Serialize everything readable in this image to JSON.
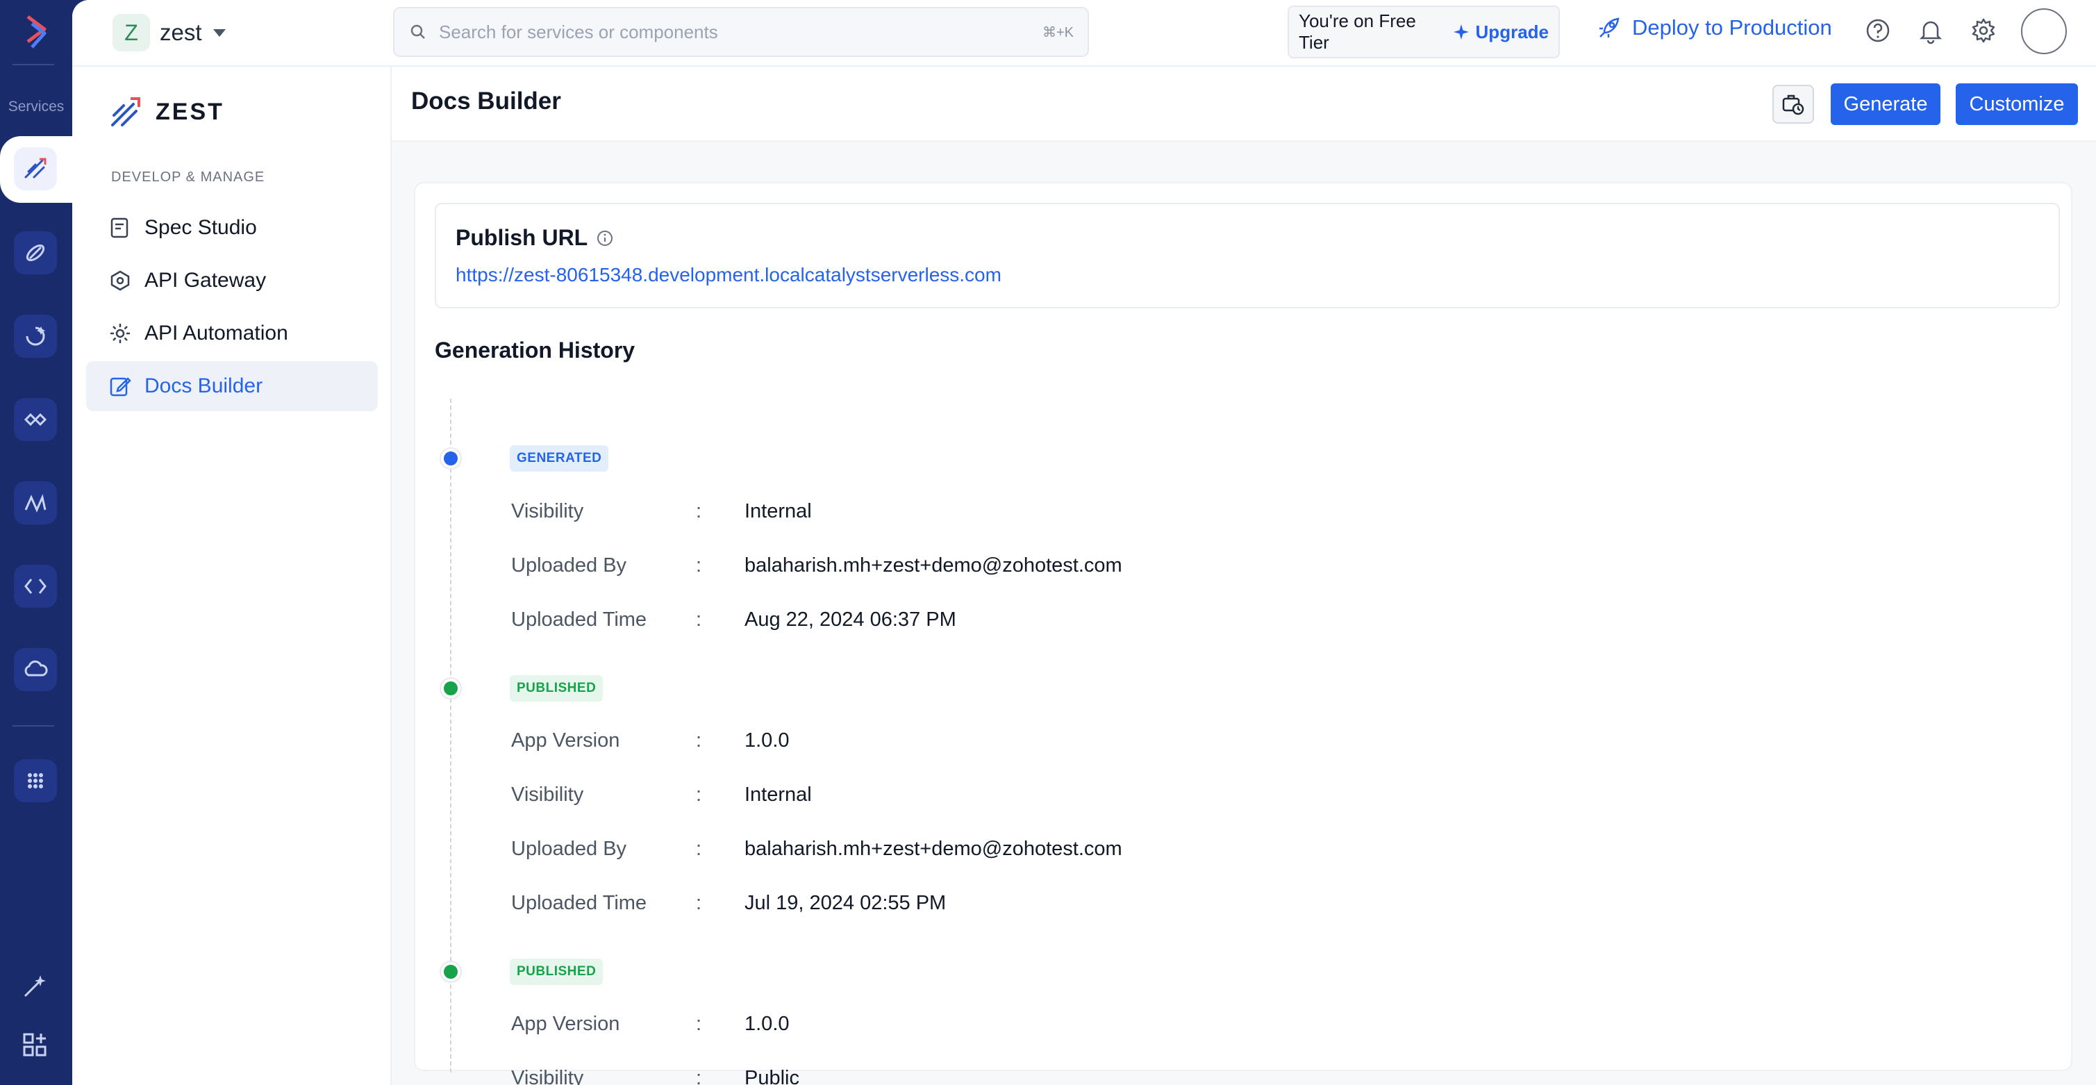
{
  "rail": {
    "services_label": "Services"
  },
  "project": {
    "initial": "Z",
    "name": "zest"
  },
  "search": {
    "placeholder": "Search for services or components",
    "shortcut": "⌘+K"
  },
  "tier": {
    "text": "You're on Free Tier",
    "upgrade_label": "Upgrade"
  },
  "deploy_label": "Deploy to Production",
  "brand": {
    "name": "ZEST"
  },
  "sidenav": {
    "section": "DEVELOP & MANAGE",
    "items": [
      {
        "label": "Spec Studio",
        "icon": "spec-studio-icon"
      },
      {
        "label": "API Gateway",
        "icon": "api-gateway-icon"
      },
      {
        "label": "API Automation",
        "icon": "api-automation-icon"
      },
      {
        "label": "Docs Builder",
        "icon": "docs-builder-icon",
        "active": true
      }
    ]
  },
  "page": {
    "title": "Docs Builder",
    "generate_label": "Generate",
    "customize_label": "Customize"
  },
  "publish": {
    "title": "Publish URL",
    "url": "https://zest-80615348.development.localcatalystserverless.com"
  },
  "history": {
    "title": "Generation History",
    "entries": [
      {
        "status": "GENERATED",
        "fields": [
          {
            "key": "Visibility",
            "sep": ":",
            "value": "Internal"
          },
          {
            "key": "Uploaded By",
            "sep": ":",
            "value": "balaharish.mh+zest+demo@zohotest.com"
          },
          {
            "key": "Uploaded Time",
            "sep": ":",
            "value": "Aug 22, 2024 06:37 PM"
          }
        ]
      },
      {
        "status": "PUBLISHED",
        "fields": [
          {
            "key": "App Version",
            "sep": ":",
            "value": "1.0.0"
          },
          {
            "key": "Visibility",
            "sep": ":",
            "value": "Internal"
          },
          {
            "key": "Uploaded By",
            "sep": ":",
            "value": "balaharish.mh+zest+demo@zohotest.com"
          },
          {
            "key": "Uploaded Time",
            "sep": ":",
            "value": "Jul 19, 2024 02:55 PM"
          }
        ]
      },
      {
        "status": "PUBLISHED",
        "fields": [
          {
            "key": "App Version",
            "sep": ":",
            "value": "1.0.0"
          },
          {
            "key": "Visibility",
            "sep": ":",
            "value": "Public"
          }
        ]
      }
    ]
  },
  "colors": {
    "rail": "#1a2b6b",
    "accent": "#2563eb",
    "generated": "#2563eb",
    "published": "#16a34a"
  }
}
